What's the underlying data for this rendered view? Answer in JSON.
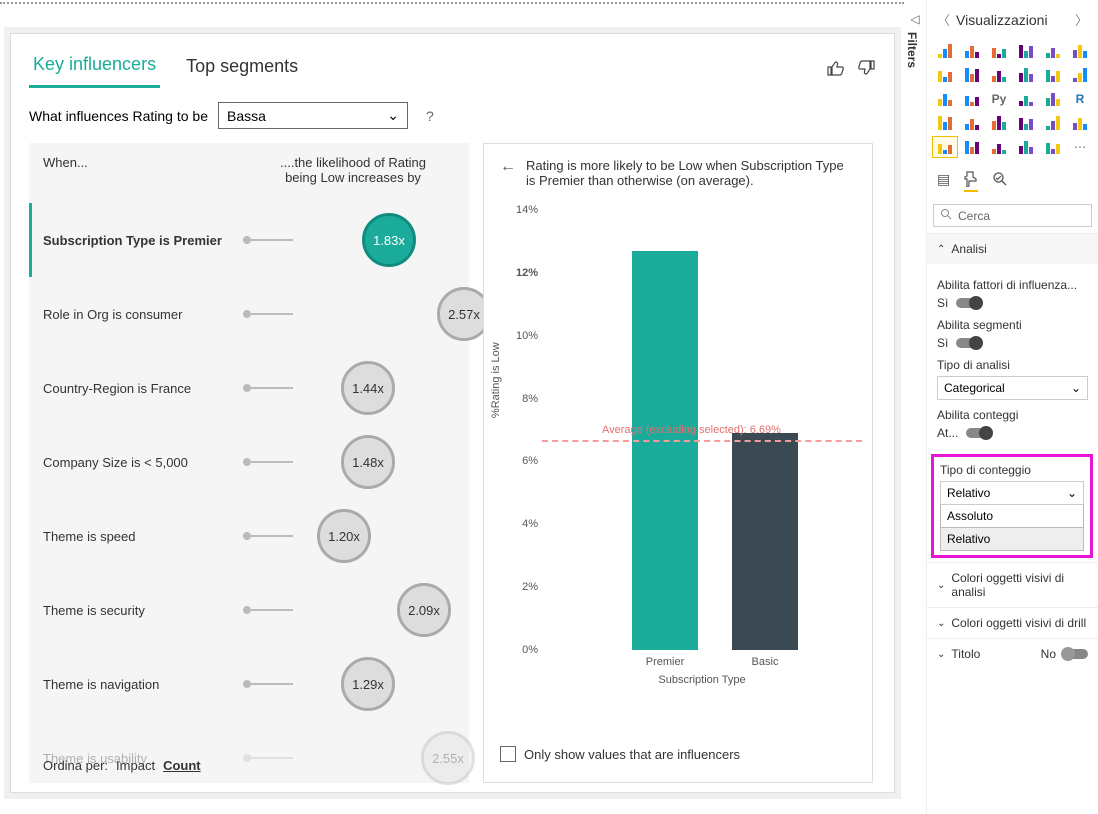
{
  "tabs": {
    "key_influencers": "Key influencers",
    "top_segments": "Top segments"
  },
  "question": {
    "prefix": "What influences Rating to be",
    "value": "Bassa",
    "help": "?"
  },
  "left": {
    "col1": "When...",
    "col2": "....the likelihood of Rating being Low increases by",
    "items": [
      {
        "label": "Subscription Type is Premier",
        "mult": "1.83x",
        "pos": 330,
        "sel": true
      },
      {
        "label": "Role in Org is consumer",
        "mult": "2.57x",
        "pos": 394
      },
      {
        "label": "Country-Region is France",
        "mult": "1.44x",
        "pos": 298
      },
      {
        "label": "Company Size is < 5,000",
        "mult": "1.48x",
        "pos": 298
      },
      {
        "label": "Theme is speed",
        "mult": "1.20x",
        "pos": 274
      },
      {
        "label": "Theme is security",
        "mult": "2.09x",
        "pos": 354
      },
      {
        "label": "Theme is navigation",
        "mult": "1.29x",
        "pos": 298
      },
      {
        "label": "Theme is usability",
        "mult": "2.55x",
        "pos": 378,
        "fade": true
      }
    ],
    "sort_label": "Ordina per:",
    "sort_impact": "Impact",
    "sort_count": "Count"
  },
  "right": {
    "headline": "Rating is more likely to be Low when Subscription Type is Premier than otherwise (on average).",
    "yaxis": "%Rating is Low",
    "ticks": [
      "14%",
      "12%",
      "10%",
      "8%",
      "6%",
      "4%",
      "2%",
      "0%"
    ],
    "avg_label": "Average (excluding selected): 6.69%",
    "x1": "Premier",
    "x2": "Basic",
    "xaxis": "Subscription Type",
    "checkbox": "Only show values that are influencers"
  },
  "chart_data": {
    "type": "bar",
    "categories": [
      "Premier",
      "Basic"
    ],
    "values": [
      12.7,
      6.9
    ],
    "reference": {
      "label": "Average (excluding selected)",
      "value": 6.69
    },
    "ylabel": "%Rating is Low",
    "xlabel": "Subscription Type",
    "ylim": [
      0,
      14
    ]
  },
  "filters": {
    "label": "Filters"
  },
  "viz": {
    "title": "Visualizzazioni",
    "search_placeholder": "Cerca",
    "analysis": "Analisi",
    "enable_influencers": "Abilita fattori di influenza...",
    "enable_segments": "Abilita segmenti",
    "on": "Sì",
    "analysis_type": "Tipo di analisi",
    "analysis_type_value": "Categorical",
    "enable_counts": "Abilita conteggi",
    "counts_on": "At...",
    "count_type": "Tipo di conteggio",
    "count_type_value": "Relativo",
    "opt_absolute": "Assoluto",
    "opt_relative": "Relativo",
    "colors_analysis": "Colori oggetti visivi di analisi",
    "colors_drill": "Colori oggetti visivi di drill",
    "title_row": "Titolo",
    "title_off": "No"
  }
}
